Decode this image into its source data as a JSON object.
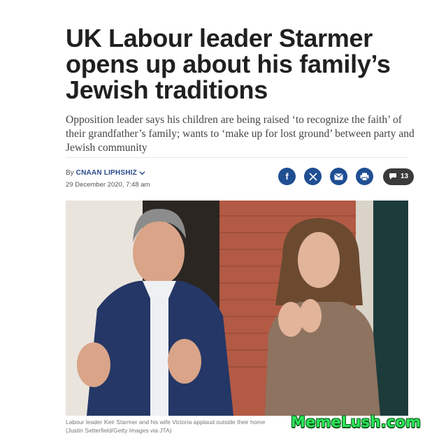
{
  "article": {
    "headline": "UK Labour leader Starmer opens up about his family’s Jewish traditions",
    "dek": "Opposition leader says his children are being raised ‘to recognize the faith’ of their grandfather’s family; wants to ‘make up for lost ground’ between party and Jewish community",
    "byline_prefix": "By",
    "author": "CNAAN LIPHSHIZ",
    "date": "29 December 2020, 7:48 am",
    "share_icons": [
      "facebook-icon",
      "x-icon",
      "email-icon",
      "print-icon"
    ],
    "comment_count": "13",
    "image_caption": "Labour leader Keir Starmer and his wife Victoria applaud outside their home",
    "image_credit": "(Justin Setterfield/Getty Images via JTA)"
  },
  "watermark": "MemeLush.com",
  "colors": {
    "share_blue": "#1f4e93",
    "comment_button": "#3a3a3a",
    "author_link": "#2a4a8a",
    "watermark_green": "#2de35a"
  }
}
